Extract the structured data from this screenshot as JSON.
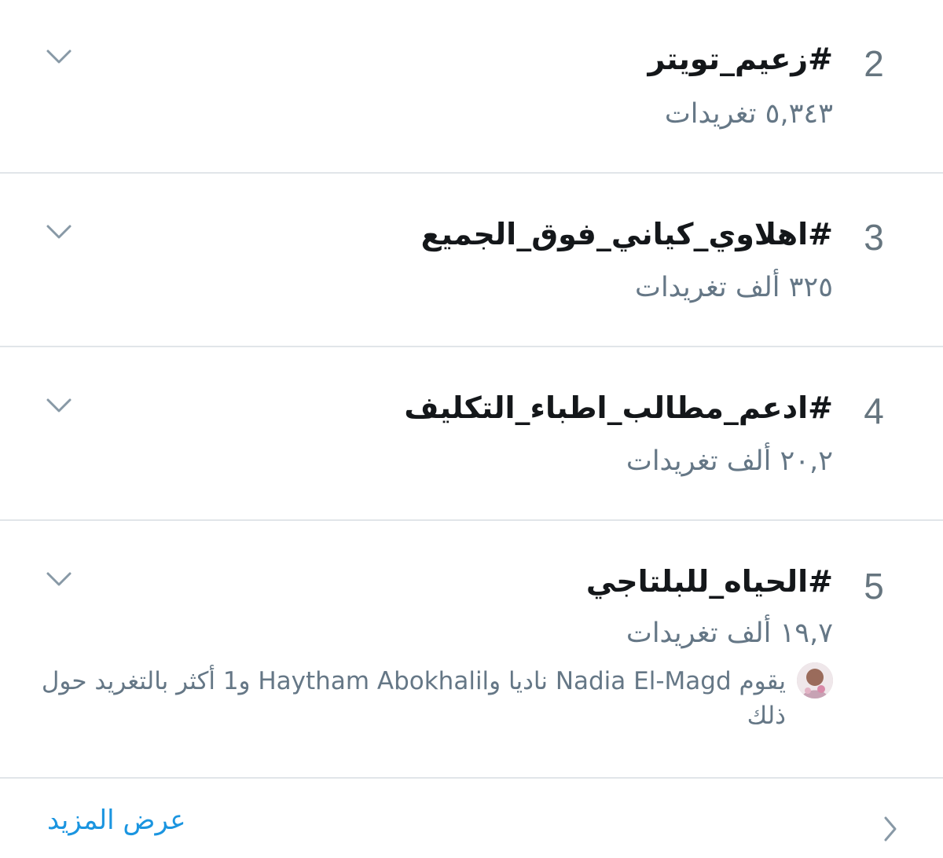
{
  "trends": [
    {
      "rank": "2",
      "hashtag": "#زعيم_تويتر",
      "count": "٥,٣٤٣ تغريدات"
    },
    {
      "rank": "3",
      "hashtag": "#اهلاوي_كياني_فوق_الجميع",
      "count": "٣٢٥ ألف تغريدات"
    },
    {
      "rank": "4",
      "hashtag": "#ادعم_مطالب_اطباء_التكليف",
      "count": "٢٠,٢ ألف تغريدات"
    },
    {
      "rank": "5",
      "hashtag": "#الحياه_للبلتاجي",
      "count": "١٩,٧ ألف تغريدات",
      "social_context": "يقوم Nadia El-Magd ناديا وHaytham Abokhalil و1 أكثر بالتغريد حول ذلك"
    }
  ],
  "footer": {
    "show_more_label": "عرض المزيد"
  },
  "colors": {
    "text_primary": "#14171a",
    "text_secondary": "#657786",
    "link": "#1b95e0",
    "divider": "#e1e5e9"
  },
  "icons": {
    "chevron": "chevron-down-icon",
    "show_more": "chevron-right-icon",
    "avatar": "user-avatar"
  }
}
